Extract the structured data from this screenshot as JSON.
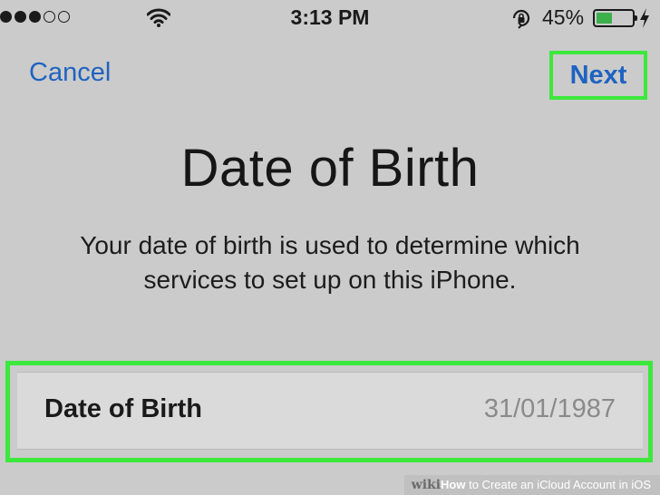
{
  "status_bar": {
    "signal_bars": 3,
    "signal_total": 5,
    "time": "3:13 PM",
    "battery_percent": "45%",
    "battery_level": 0.45,
    "battery_color": "#3cb04a",
    "icons": [
      "wifi-icon",
      "orientation-lock-icon",
      "battery-icon",
      "charging-bolt-icon"
    ]
  },
  "nav": {
    "cancel_label": "Cancel",
    "next_label": "Next",
    "accent_color": "#1f63c0"
  },
  "page": {
    "title": "Date of Birth",
    "description": "Your date of birth is used to determine which services to set up on this iPhone."
  },
  "dob_field": {
    "label": "Date of Birth",
    "value": "31/01/1987"
  },
  "highlight_color": "#3ce83c",
  "watermark": {
    "brand": "wiki",
    "how": "How",
    "rest": " to Create an iCloud Account in iOS"
  }
}
